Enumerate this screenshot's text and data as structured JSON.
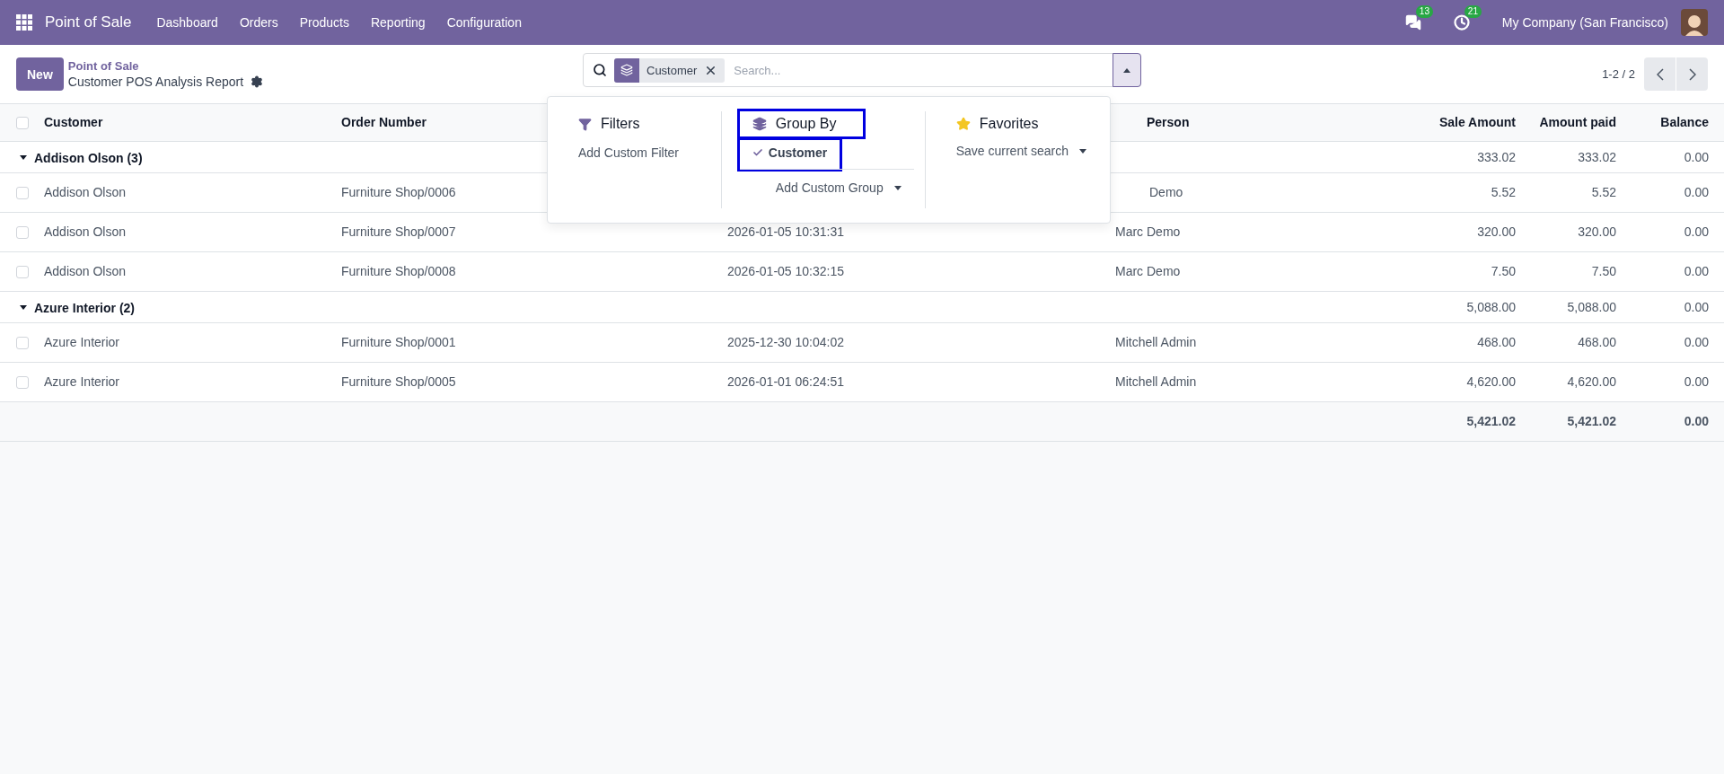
{
  "navbar": {
    "app": "Point of Sale",
    "menu": [
      "Dashboard",
      "Orders",
      "Products",
      "Reporting",
      "Configuration"
    ],
    "messages_count": "13",
    "activities_count": "21",
    "company": "My Company (San Francisco)"
  },
  "control_panel": {
    "new_button": "New",
    "breadcrumb": "Point of Sale",
    "title": "Customer POS Analysis Report",
    "facets": [
      {
        "label": "Customer"
      }
    ],
    "search": {
      "placeholder": "Search..."
    },
    "pager": "1-2 / 2"
  },
  "search_panel": {
    "filters": {
      "title": "Filters",
      "items": [
        "Add Custom Filter"
      ]
    },
    "group_by": {
      "title": "Group By",
      "highlighted": true,
      "options": [
        {
          "label": "Customer",
          "selected": true,
          "highlighted": true
        }
      ],
      "add_custom": "Add Custom Group"
    },
    "favorites": {
      "title": "Favorites",
      "save": "Save current search"
    }
  },
  "table": {
    "header_checked": false,
    "headers": {
      "customer": "Customer",
      "order_number": "Order Number",
      "salesperson": "Person",
      "sale_amount": "Sale Amount",
      "amount_paid": "Amount paid",
      "balance": "Balance"
    },
    "groups": [
      {
        "label": "Addison Olson (3)",
        "expanded": true,
        "sale_amount": "333.02",
        "amount_paid": "333.02",
        "balance": "0.00",
        "rows": [
          {
            "checked": false,
            "customer": "Addison Olson",
            "order_number": "Furniture Shop/0006",
            "salesperson": "Demo",
            "sale_amount": "5.52",
            "amount_paid": "5.52",
            "balance": "0.00"
          },
          {
            "checked": false,
            "customer": "Addison Olson",
            "order_number": "Furniture Shop/0007",
            "date": "2026-01-05 10:31:31",
            "salesperson": "Marc Demo",
            "sale_amount": "320.00",
            "amount_paid": "320.00",
            "balance": "0.00"
          },
          {
            "checked": false,
            "customer": "Addison Olson",
            "order_number": "Furniture Shop/0008",
            "date": "2026-01-05 10:32:15",
            "salesperson": "Marc Demo",
            "sale_amount": "7.50",
            "amount_paid": "7.50",
            "balance": "0.00"
          }
        ]
      },
      {
        "label": "Azure Interior (2)",
        "expanded": true,
        "sale_amount": "5,088.00",
        "amount_paid": "5,088.00",
        "balance": "0.00",
        "rows": [
          {
            "checked": false,
            "customer": "Azure Interior",
            "order_number": "Furniture Shop/0001",
            "date": "2025-12-30 10:04:02",
            "salesperson": "Mitchell Admin",
            "sale_amount": "468.00",
            "amount_paid": "468.00",
            "balance": "0.00"
          },
          {
            "checked": false,
            "customer": "Azure Interior",
            "order_number": "Furniture Shop/0005",
            "date": "2026-01-01 06:24:51",
            "salesperson": "Mitchell Admin",
            "sale_amount": "4,620.00",
            "amount_paid": "4,620.00",
            "balance": "0.00"
          }
        ]
      }
    ],
    "totals": {
      "sale_amount": "5,421.02",
      "amount_paid": "5,421.02",
      "balance": "0.00"
    }
  }
}
